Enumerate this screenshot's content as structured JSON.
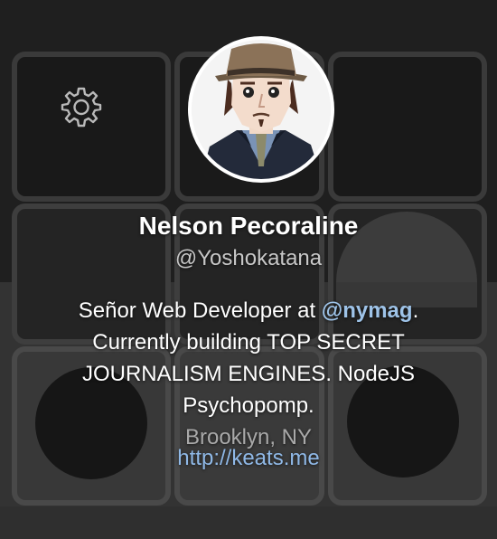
{
  "profile": {
    "name": "Nelson Pecoraline",
    "handle": "@Yoshokatana",
    "bio": {
      "prefix": "Señor Web Developer at ",
      "mention": "@nymag",
      "suffix": ". Currently building TOP SECRET JOURNALISM ENGINES. NodeJS Psychopomp."
    },
    "location": "Brooklyn, NY",
    "url": "http://keats.me"
  },
  "icons": {
    "settings": "gear-icon",
    "avatar": "avatar-illustration"
  },
  "colors": {
    "background": "#2e2e2e",
    "mention": "#9ec3e8",
    "url": "#8fb8e6",
    "handle": "#c7c7c7",
    "location": "#a9a9a9",
    "text": "#ffffff"
  }
}
